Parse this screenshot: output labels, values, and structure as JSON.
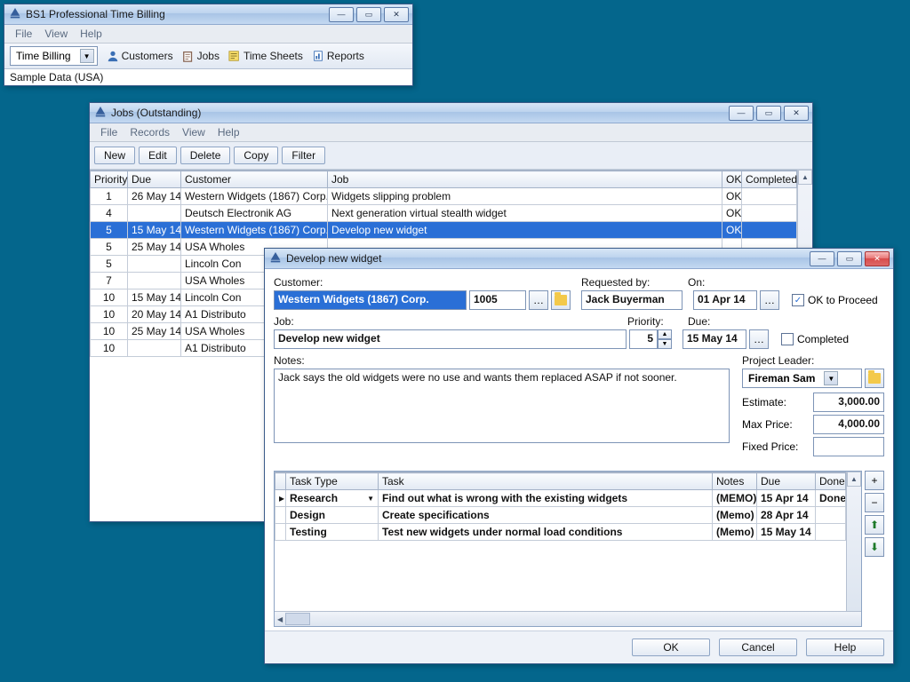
{
  "main": {
    "title": "BS1 Professional Time Billing",
    "menus": [
      "File",
      "View",
      "Help"
    ],
    "combo": "Time Billing",
    "toolbar": [
      {
        "icon": "customers-icon",
        "label": "Customers"
      },
      {
        "icon": "jobs-icon",
        "label": "Jobs"
      },
      {
        "icon": "timesheets-icon",
        "label": "Time Sheets"
      },
      {
        "icon": "reports-icon",
        "label": "Reports"
      }
    ],
    "sample": "Sample Data (USA)"
  },
  "jobs": {
    "title": "Jobs (Outstanding)",
    "menus": [
      "File",
      "Records",
      "View",
      "Help"
    ],
    "buttons": [
      "New",
      "Edit",
      "Delete",
      "Copy",
      "Filter"
    ],
    "columns": [
      "Priority",
      "Due",
      "Customer",
      "Job",
      "OK",
      "Completed"
    ],
    "rows": [
      {
        "p": "1",
        "due": "26 May 14",
        "cust": "Western Widgets (1867) Corp.",
        "job": "Widgets slipping problem",
        "ok": "OK",
        "comp": ""
      },
      {
        "p": "4",
        "due": "",
        "cust": "Deutsch Electronik AG",
        "job": "Next generation virtual stealth widget",
        "ok": "OK",
        "comp": ""
      },
      {
        "p": "5",
        "due": "15 May 14",
        "cust": "Western Widgets (1867) Corp.",
        "job": "Develop new widget",
        "ok": "OK",
        "comp": "",
        "sel": true
      },
      {
        "p": "5",
        "due": "25 May 14",
        "cust": "USA Wholes",
        "job": "",
        "ok": "",
        "comp": ""
      },
      {
        "p": "5",
        "due": "",
        "cust": "Lincoln Con",
        "job": "",
        "ok": "",
        "comp": ""
      },
      {
        "p": "7",
        "due": "",
        "cust": "USA Wholes",
        "job": "",
        "ok": "",
        "comp": ""
      },
      {
        "p": "10",
        "due": "15 May 14",
        "cust": "Lincoln Con",
        "job": "",
        "ok": "",
        "comp": ""
      },
      {
        "p": "10",
        "due": "20 May 14",
        "cust": "A1 Distributo",
        "job": "",
        "ok": "",
        "comp": ""
      },
      {
        "p": "10",
        "due": "25 May 14",
        "cust": "USA Wholes",
        "job": "",
        "ok": "",
        "comp": ""
      },
      {
        "p": "10",
        "due": "",
        "cust": "A1 Distributo",
        "job": "",
        "ok": "",
        "comp": ""
      }
    ]
  },
  "detail": {
    "title": "Develop new widget",
    "labels": {
      "customer": "Customer:",
      "job": "Job:",
      "notes": "Notes:",
      "req": "Requested by:",
      "on": "On:",
      "priority": "Priority:",
      "due": "Due:",
      "okp": "OK to Proceed",
      "completed": "Completed",
      "pl": "Project Leader:",
      "est": "Estimate:",
      "max": "Max Price:",
      "fixed": "Fixed Price:"
    },
    "values": {
      "customer": "Western Widgets (1867) Corp.",
      "custno": "1005",
      "job": "Develop new widget",
      "req": "Jack Buyerman",
      "on": "01 Apr 14",
      "priority": "5",
      "due": "15 May 14",
      "notes": "Jack says the old widgets were no use and wants them replaced ASAP if not sooner.",
      "pl": "Fireman Sam",
      "est": "3,000.00",
      "max": "4,000.00",
      "fixed": ""
    },
    "okChecked": true,
    "completedChecked": false,
    "tasks": {
      "columns": [
        "Task Type",
        "Task",
        "Notes",
        "Due",
        "Done"
      ],
      "rows": [
        {
          "type": "Research",
          "task": "Find out what is wrong with the existing widgets",
          "notes": "(MEMO)",
          "due": "15 Apr 14",
          "done": "Done"
        },
        {
          "type": "Design",
          "task": "Create specifications",
          "notes": "(Memo)",
          "due": "28 Apr 14",
          "done": ""
        },
        {
          "type": "Testing",
          "task": "Test new widgets under normal load conditions",
          "notes": "(Memo)",
          "due": "15 May 14",
          "done": ""
        }
      ]
    },
    "footer": {
      "ok": "OK",
      "cancel": "Cancel",
      "help": "Help"
    }
  }
}
